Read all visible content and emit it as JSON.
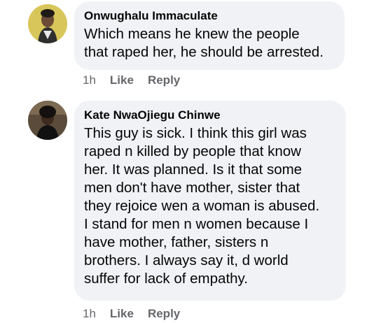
{
  "comments": [
    {
      "author": "Onwughalu Immaculate",
      "text": "Which means he knew the people\nthat raped her, he should be arrested.",
      "time": "1h",
      "like_label": "Like",
      "reply_label": "Reply"
    },
    {
      "author": "Kate NwaOjiegu Chinwe",
      "text": "This guy is sick. I think this girl was\nraped n killed by people that know\nher. It was planned. Is it that some\nmen don't have mother, sister that\nthey rejoice wen a woman is abused.\nI stand for men n women because I\nhave mother, father, sisters n\nbrothers. I always say it, d world\nsuffer for lack of empathy.",
      "time": "1h",
      "like_label": "Like",
      "reply_label": "Reply"
    }
  ],
  "colors": {
    "bubble": "#f0f2f5",
    "meta_text": "#65676b",
    "author_text": "#050505"
  }
}
